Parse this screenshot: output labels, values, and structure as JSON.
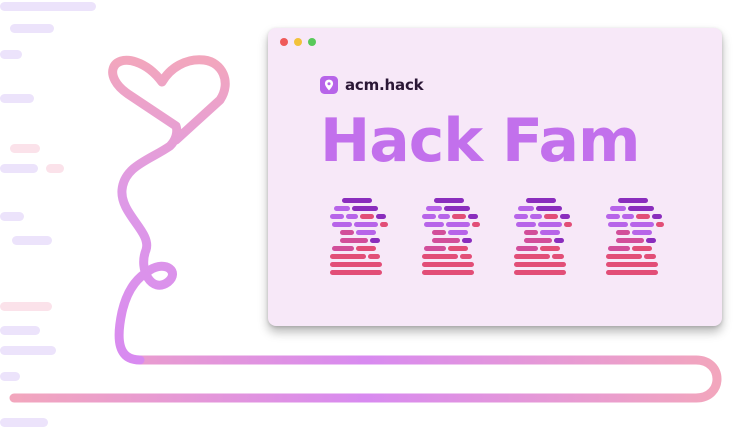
{
  "window": {
    "brand": {
      "name": "acm.hack",
      "icon": "acm-hack-logo-icon"
    },
    "headline": "Hack Fam",
    "figure_count": 4
  },
  "colors": {
    "headline": "#c270ec",
    "window_bg": "#f7e8f8",
    "dot_red": "#ef5a5a",
    "dot_yellow": "#f2c23b",
    "dot_green": "#58c95a",
    "code_purple_dark": "#8a2dbd",
    "code_purple": "#b764e9",
    "code_magenta": "#d24e9a",
    "code_pink": "#e24e77",
    "rope_pink": "#f2a6bd",
    "rope_purple": "#d88af0"
  }
}
